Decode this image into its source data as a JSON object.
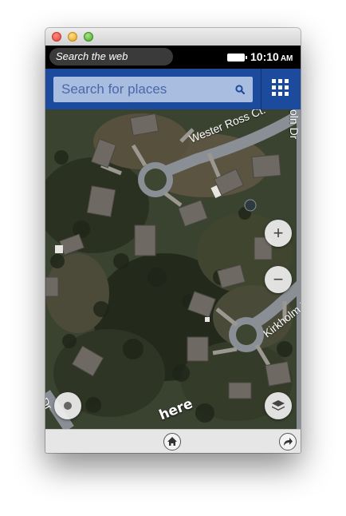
{
  "statusbar": {
    "web_search_label": "Search the web",
    "time": "10:10",
    "ampm": "AM"
  },
  "appbar": {
    "search_placeholder": "Search for places",
    "search_icon": "search-icon",
    "menu_icon": "grid-icon"
  },
  "map": {
    "streets": [
      "Wester Ross Ct.",
      "Kirkholm D",
      "oln Dr",
      "Dr"
    ],
    "zoom_in_label": "+",
    "zoom_out_label": "−",
    "logo_text": "here",
    "locate_icon": "location-icon",
    "layers_icon": "layers-icon"
  },
  "bottombar": {
    "home_icon": "home-icon",
    "forward_icon": "forward-icon"
  },
  "colors": {
    "appbar": "#1c4a9c",
    "search_field": "#a9bde1",
    "statusbar": "#000000"
  }
}
